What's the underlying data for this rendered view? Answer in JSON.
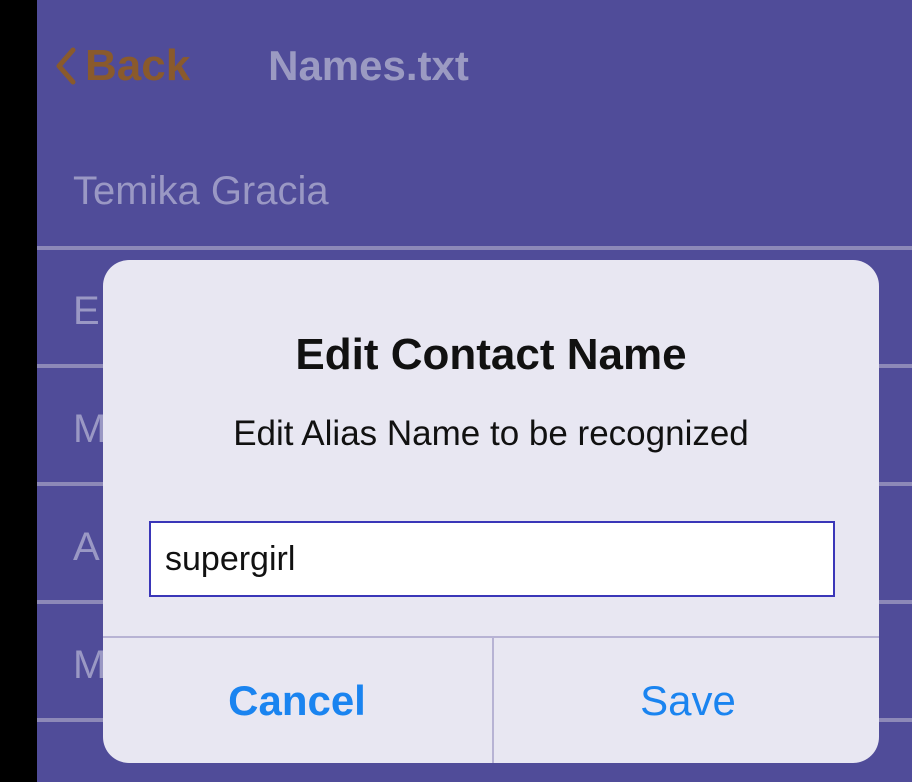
{
  "nav": {
    "back_label": "Back",
    "title": "Names.txt"
  },
  "list": {
    "rows": [
      {
        "label": "Temika Gracia"
      },
      {
        "label": "E"
      },
      {
        "label": "M"
      },
      {
        "label": "A"
      },
      {
        "label": "M"
      }
    ]
  },
  "alert": {
    "title": "Edit Contact Name",
    "message": "Edit Alias Name to be recognized",
    "input_value": "supergirl",
    "cancel_label": "Cancel",
    "save_label": "Save"
  },
  "colors": {
    "background": "#504c99",
    "accent": "#1a84f0",
    "back_accent": "#8a5a2c"
  }
}
